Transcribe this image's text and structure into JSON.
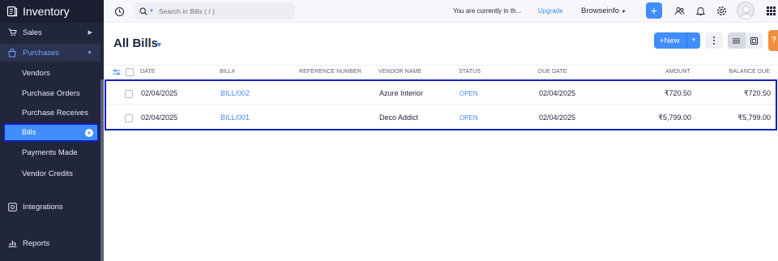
{
  "app": {
    "title": "Inventory"
  },
  "sidebar": {
    "items": [
      {
        "label": "Sales"
      },
      {
        "label": "Purchases"
      },
      {
        "label": "Integrations"
      },
      {
        "label": "Reports"
      }
    ],
    "purchases_sub": [
      {
        "label": "Vendors"
      },
      {
        "label": "Purchase Orders"
      },
      {
        "label": "Purchase Receives"
      },
      {
        "label": "Bills"
      },
      {
        "label": "Payments Made"
      },
      {
        "label": "Vendor Credits"
      }
    ]
  },
  "topbar": {
    "search_placeholder": "Search in Bills ( / )",
    "notice": "You are currently in th...",
    "upgrade": "Upgrade",
    "org": "Browseinfo"
  },
  "header": {
    "title": "All Bills",
    "new_label": "+New",
    "help": "?"
  },
  "table": {
    "columns": [
      "DATE",
      "BILL#",
      "REFERENCE NUMBER",
      "VENDOR NAME",
      "STATUS",
      "DUE DATE",
      "AMOUNT",
      "BALANCE DUE"
    ],
    "rows": [
      {
        "date": "02/04/2025",
        "bill": "BILL/002",
        "reference": "",
        "vendor": "Azure Interior",
        "status": "OPEN",
        "due_date": "02/04/2025",
        "amount": "₹720.50",
        "balance": "₹720.50"
      },
      {
        "date": "02/04/2025",
        "bill": "BILL/001",
        "reference": "",
        "vendor": "Deco Addict",
        "status": "OPEN",
        "due_date": "02/04/2025",
        "amount": "₹5,799.00",
        "balance": "₹5,799.00"
      }
    ]
  },
  "colors": {
    "accent": "#408dfb",
    "sidebar": "#21263b",
    "highlight": "#1020c8"
  }
}
